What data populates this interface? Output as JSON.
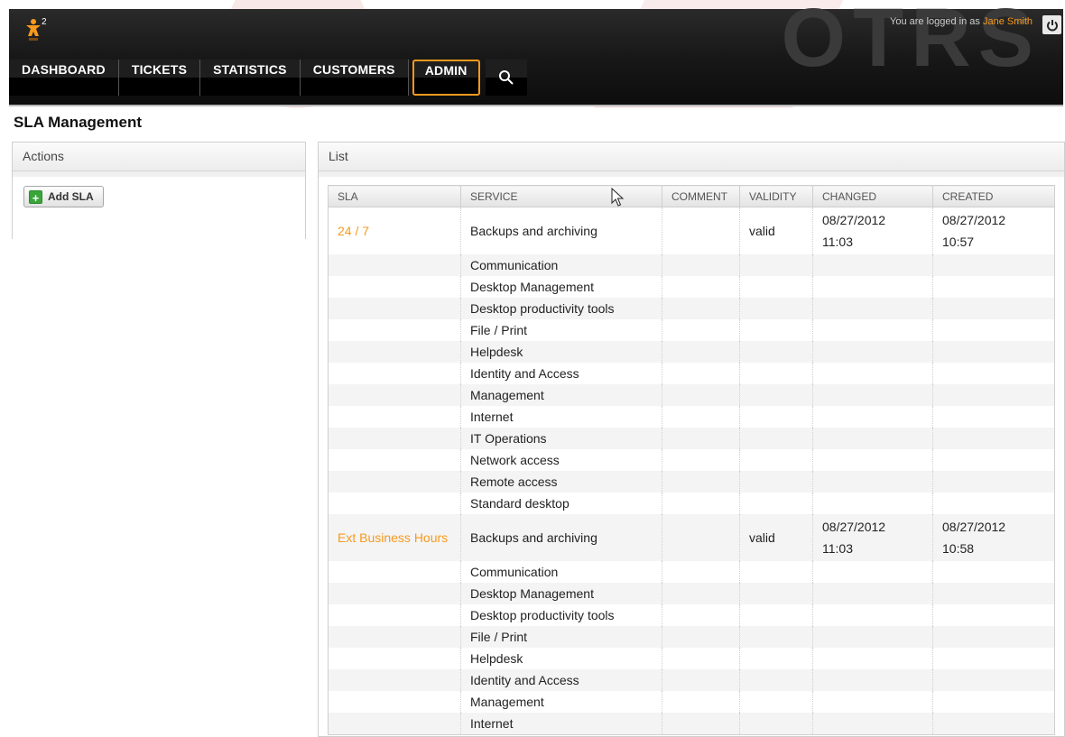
{
  "header": {
    "brand": "OTRS",
    "logged_in_prefix": "You are logged in as",
    "user_name": "Jane Smith",
    "logo_superscript": "2"
  },
  "nav": [
    {
      "label": "DASHBOARD",
      "active": false
    },
    {
      "label": "TICKETS",
      "active": false
    },
    {
      "label": "STATISTICS",
      "active": false
    },
    {
      "label": "CUSTOMERS",
      "active": false
    },
    {
      "label": "ADMIN",
      "active": true
    }
  ],
  "page": {
    "title": "SLA Management"
  },
  "actions": {
    "title": "Actions",
    "add_button": "Add SLA"
  },
  "list": {
    "title": "List",
    "columns": [
      "SLA",
      "SERVICE",
      "COMMENT",
      "VALIDITY",
      "CHANGED",
      "CREATED"
    ],
    "slas": [
      {
        "name": "24 / 7",
        "first_service": "Backups and archiving",
        "comment": "",
        "validity": "valid",
        "changed_date": "08/27/2012",
        "changed_time": "11:03",
        "created_date": "08/27/2012",
        "created_time": "10:57",
        "more_services": [
          "Communication",
          "Desktop Management",
          "Desktop productivity tools",
          "File / Print",
          "Helpdesk",
          "Identity and Access",
          "Management",
          "Internet",
          "IT Operations",
          "Network access",
          "Remote access",
          "Standard desktop"
        ]
      },
      {
        "name": "Ext Business Hours",
        "first_service": "Backups and archiving",
        "comment": "",
        "validity": "valid",
        "changed_date": "08/27/2012",
        "changed_time": "11:03",
        "created_date": "08/27/2012",
        "created_time": "10:58",
        "more_services": [
          "Communication",
          "Desktop Management",
          "Desktop productivity tools",
          "File / Print",
          "Helpdesk",
          "Identity and Access",
          "Management",
          "Internet"
        ]
      }
    ]
  },
  "colors": {
    "accent": "#f79a1e",
    "header_bg": "#1a1a1a",
    "add_icon": "#3aa63a"
  }
}
